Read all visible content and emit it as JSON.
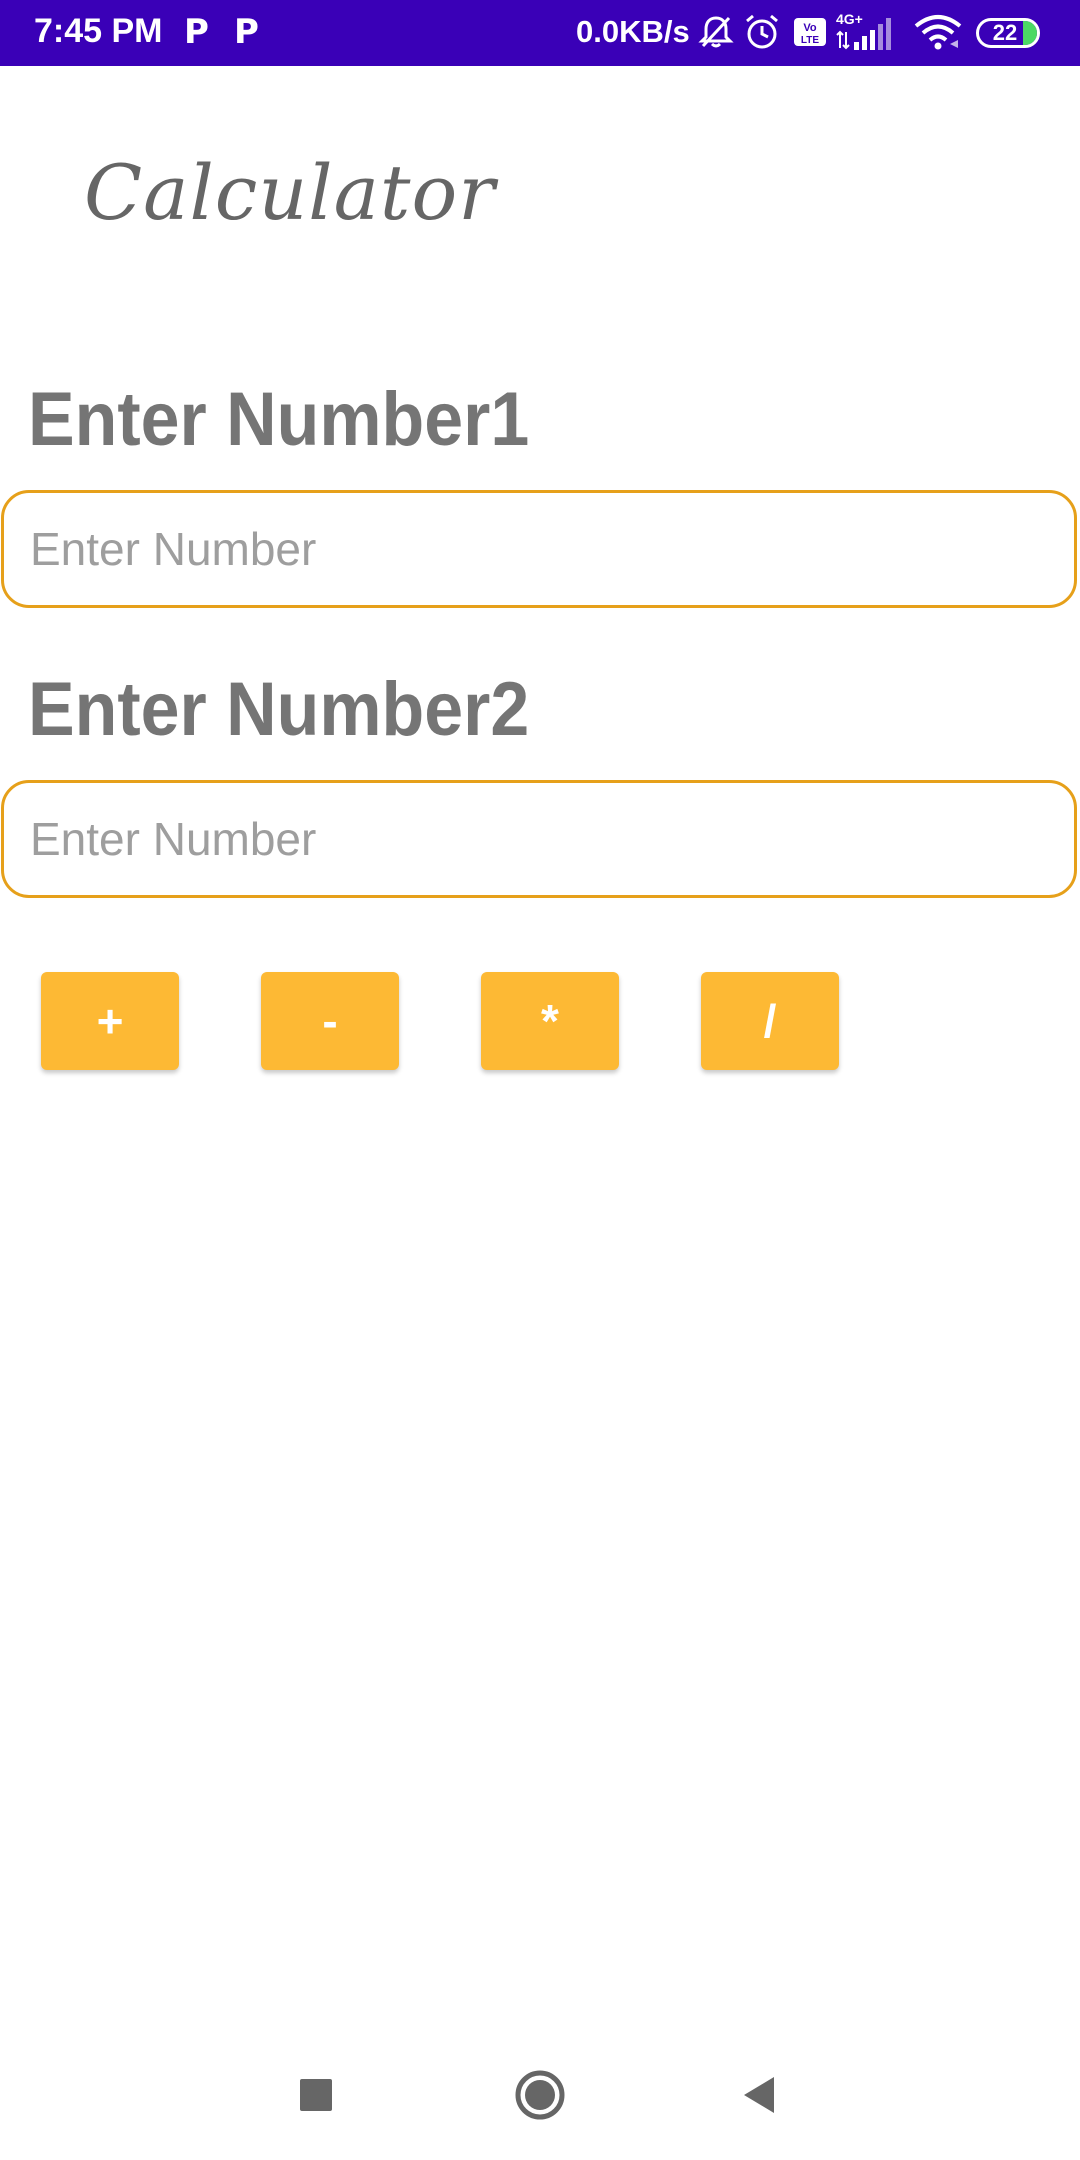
{
  "status_bar": {
    "time": "7:45 PM",
    "notification_icons": [
      "P",
      "P"
    ],
    "network_speed": "0.0KB/s",
    "icons": [
      "bell-off-icon",
      "alarm-icon",
      "volte-icon",
      "4g-signal-icon",
      "wifi-icon",
      "battery-icon"
    ],
    "network_type": "4G+",
    "volte_label": "Vo LTE",
    "battery_level": "22",
    "background_color": "#3a00b7"
  },
  "app": {
    "title": "Calculator",
    "number1": {
      "label": "Enter Number1",
      "value": "",
      "placeholder": "Enter Number"
    },
    "number2": {
      "label": "Enter Number2",
      "value": "",
      "placeholder": "Enter Number"
    },
    "operations": [
      {
        "label": "+"
      },
      {
        "label": "-"
      },
      {
        "label": "*"
      },
      {
        "label": "/"
      }
    ],
    "accent_color": "#fdb934",
    "field_border_color": "#e6a01a"
  },
  "navigation_bar": {
    "buttons": [
      "recent-apps-icon",
      "home-icon",
      "back-icon"
    ]
  }
}
